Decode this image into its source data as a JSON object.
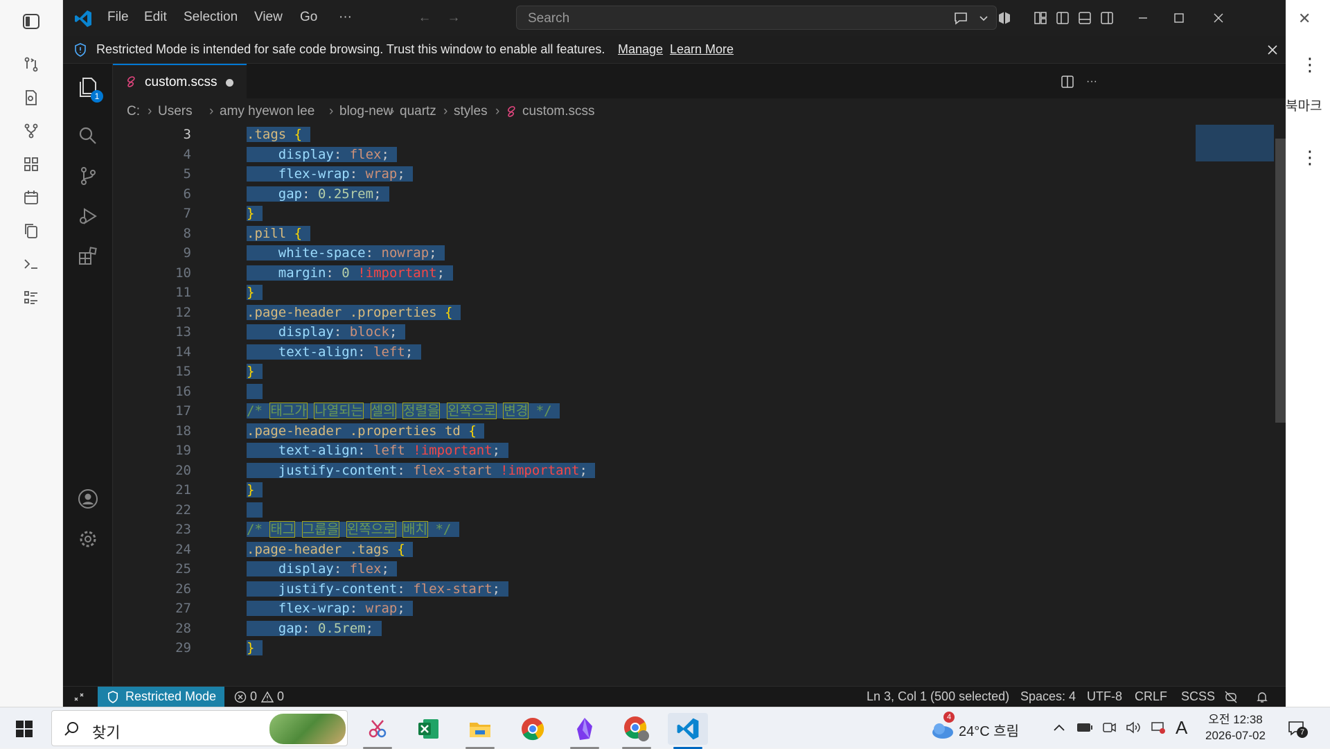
{
  "vscode": {
    "menu": [
      "File",
      "Edit",
      "Selection",
      "View",
      "Go",
      "···"
    ],
    "search_placeholder": "Search",
    "banner": {
      "message": "Restricted Mode is intended for safe code browsing. Trust this window to enable all features.",
      "manage": "Manage",
      "learn_more": "Learn More"
    },
    "explorer_badge": "1",
    "tab": {
      "filename": "custom.scss"
    },
    "breadcrumb": [
      "C:",
      "Users",
      "amy hyewon lee",
      "blog-new",
      "quartz",
      "styles",
      "custom.scss"
    ],
    "code_lines": [
      {
        "n": "3",
        "tokens": [
          [
            ".tags",
            "sel"
          ],
          [
            " ",
            "p"
          ],
          [
            "{",
            "brace"
          ]
        ]
      },
      {
        "n": "4",
        "tokens": [
          [
            "    ",
            "p"
          ],
          [
            "display",
            "prop"
          ],
          [
            ": ",
            "p"
          ],
          [
            "flex",
            "val"
          ],
          [
            ";",
            "p"
          ]
        ]
      },
      {
        "n": "5",
        "tokens": [
          [
            "    ",
            "p"
          ],
          [
            "flex-wrap",
            "prop"
          ],
          [
            ": ",
            "p"
          ],
          [
            "wrap",
            "val"
          ],
          [
            ";",
            "p"
          ]
        ]
      },
      {
        "n": "6",
        "tokens": [
          [
            "    ",
            "p"
          ],
          [
            "gap",
            "prop"
          ],
          [
            ": ",
            "p"
          ],
          [
            "0.25rem",
            "num"
          ],
          [
            ";",
            "p"
          ]
        ]
      },
      {
        "n": "7",
        "tokens": [
          [
            "}",
            "brace"
          ]
        ]
      },
      {
        "n": "8",
        "tokens": [
          [
            ".pill",
            "sel"
          ],
          [
            " ",
            "p"
          ],
          [
            "{",
            "brace"
          ]
        ]
      },
      {
        "n": "9",
        "tokens": [
          [
            "    ",
            "p"
          ],
          [
            "white-space",
            "prop"
          ],
          [
            ": ",
            "p"
          ],
          [
            "nowrap",
            "val"
          ],
          [
            ";",
            "p"
          ]
        ]
      },
      {
        "n": "10",
        "tokens": [
          [
            "    ",
            "p"
          ],
          [
            "margin",
            "prop"
          ],
          [
            ": ",
            "p"
          ],
          [
            "0",
            "num"
          ],
          [
            " ",
            "p"
          ],
          [
            "!important",
            "imp"
          ],
          [
            ";",
            "p"
          ]
        ]
      },
      {
        "n": "11",
        "tokens": [
          [
            "}",
            "brace"
          ]
        ]
      },
      {
        "n": "12",
        "tokens": [
          [
            ".page-header .properties",
            "sel"
          ],
          [
            " ",
            "p"
          ],
          [
            "{",
            "brace"
          ]
        ]
      },
      {
        "n": "13",
        "tokens": [
          [
            "    ",
            "p"
          ],
          [
            "display",
            "prop"
          ],
          [
            ": ",
            "p"
          ],
          [
            "block",
            "val"
          ],
          [
            ";",
            "p"
          ]
        ]
      },
      {
        "n": "14",
        "tokens": [
          [
            "    ",
            "p"
          ],
          [
            "text-align",
            "prop"
          ],
          [
            ": ",
            "p"
          ],
          [
            "left",
            "val"
          ],
          [
            ";",
            "p"
          ]
        ]
      },
      {
        "n": "15",
        "tokens": [
          [
            "}",
            "brace"
          ]
        ]
      },
      {
        "n": "16",
        "tokens": []
      },
      {
        "n": "17",
        "tokens": [
          [
            "/* ",
            "cmt"
          ],
          [
            "태그가",
            "cmtko"
          ],
          [
            " ",
            "cmt"
          ],
          [
            "나열되는",
            "cmtko"
          ],
          [
            " ",
            "cmt"
          ],
          [
            "셀의",
            "cmtko"
          ],
          [
            " ",
            "cmt"
          ],
          [
            "정렬을",
            "cmtko"
          ],
          [
            " ",
            "cmt"
          ],
          [
            "왼쪽으로",
            "cmtko"
          ],
          [
            " ",
            "cmt"
          ],
          [
            "변경",
            "cmtko"
          ],
          [
            " */",
            "cmt"
          ]
        ]
      },
      {
        "n": "18",
        "tokens": [
          [
            ".page-header .properties td",
            "sel"
          ],
          [
            " ",
            "p"
          ],
          [
            "{",
            "brace"
          ]
        ]
      },
      {
        "n": "19",
        "tokens": [
          [
            "    ",
            "p"
          ],
          [
            "text-align",
            "prop"
          ],
          [
            ": ",
            "p"
          ],
          [
            "left",
            "val"
          ],
          [
            " ",
            "p"
          ],
          [
            "!important",
            "imp"
          ],
          [
            ";",
            "p"
          ]
        ]
      },
      {
        "n": "20",
        "tokens": [
          [
            "    ",
            "p"
          ],
          [
            "justify-content",
            "prop"
          ],
          [
            ": ",
            "p"
          ],
          [
            "flex-start",
            "val"
          ],
          [
            " ",
            "p"
          ],
          [
            "!important",
            "imp"
          ],
          [
            ";",
            "p"
          ]
        ]
      },
      {
        "n": "21",
        "tokens": [
          [
            "}",
            "brace"
          ]
        ]
      },
      {
        "n": "22",
        "tokens": []
      },
      {
        "n": "23",
        "tokens": [
          [
            "/* ",
            "cmt"
          ],
          [
            "태그",
            "cmtko"
          ],
          [
            " ",
            "cmt"
          ],
          [
            "그룹을",
            "cmtko"
          ],
          [
            " ",
            "cmt"
          ],
          [
            "왼쪽으로",
            "cmtko"
          ],
          [
            " ",
            "cmt"
          ],
          [
            "배치",
            "cmtko"
          ],
          [
            " */",
            "cmt"
          ]
        ]
      },
      {
        "n": "24",
        "tokens": [
          [
            ".page-header .tags",
            "sel"
          ],
          [
            " ",
            "p"
          ],
          [
            "{",
            "brace"
          ]
        ]
      },
      {
        "n": "25",
        "tokens": [
          [
            "    ",
            "p"
          ],
          [
            "display",
            "prop"
          ],
          [
            ": ",
            "p"
          ],
          [
            "flex",
            "val"
          ],
          [
            ";",
            "p"
          ]
        ]
      },
      {
        "n": "26",
        "tokens": [
          [
            "    ",
            "p"
          ],
          [
            "justify-content",
            "prop"
          ],
          [
            ": ",
            "p"
          ],
          [
            "flex-start",
            "val"
          ],
          [
            ";",
            "p"
          ]
        ]
      },
      {
        "n": "27",
        "tokens": [
          [
            "    ",
            "p"
          ],
          [
            "flex-wrap",
            "prop"
          ],
          [
            ": ",
            "p"
          ],
          [
            "wrap",
            "val"
          ],
          [
            ";",
            "p"
          ]
        ]
      },
      {
        "n": "28",
        "tokens": [
          [
            "    ",
            "p"
          ],
          [
            "gap",
            "prop"
          ],
          [
            ": ",
            "p"
          ],
          [
            "0.5rem",
            "num"
          ],
          [
            ";",
            "p"
          ]
        ]
      },
      {
        "n": "29",
        "tokens": [
          [
            "}",
            "brace"
          ]
        ]
      }
    ],
    "status": {
      "restricted": "Restricted Mode",
      "errors": "0",
      "warnings": "0",
      "position": "Ln 3, Col 1 (500 selected)",
      "spaces": "Spaces: 4",
      "encoding": "UTF-8",
      "eol": "CRLF",
      "language": "SCSS"
    }
  },
  "background_app": {
    "partial_text": "북마크"
  },
  "taskbar": {
    "search_text": "찾기",
    "weather_badge": "4",
    "weather": "24°C 흐림",
    "ime": "A",
    "time": "오전 12:38",
    "date": "2026-07-02",
    "notification_count": "7"
  },
  "colors": {
    "accent": "#0078d4",
    "selection": "#264f78",
    "restricted_badge": "#1b81a8"
  }
}
